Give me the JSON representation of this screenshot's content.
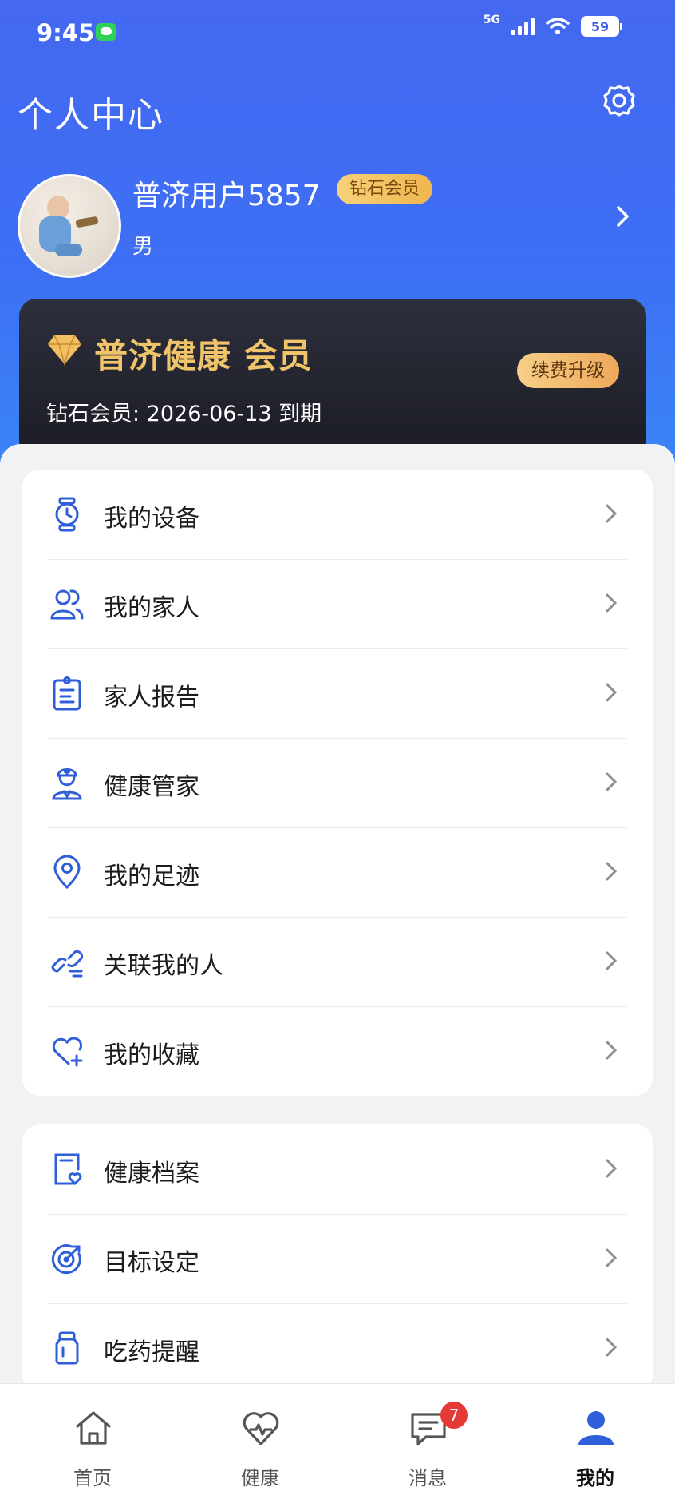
{
  "status_bar": {
    "time": "9:45",
    "network": "5G",
    "battery": "59"
  },
  "header": {
    "title": "个人中心"
  },
  "profile": {
    "name": "普济用户5857",
    "level_badge": "钻石会员",
    "gender": "男"
  },
  "member_card": {
    "title": "普济健康 会员",
    "expiry": "钻石会员: 2026-06-13 到期",
    "renew_button": "续费升级"
  },
  "menu_group_1": [
    {
      "label": "我的设备",
      "icon": "watch-icon"
    },
    {
      "label": "我的家人",
      "icon": "family-icon"
    },
    {
      "label": "家人报告",
      "icon": "clipboard-icon"
    },
    {
      "label": "健康管家",
      "icon": "doctor-icon"
    },
    {
      "label": "我的足迹",
      "icon": "location-pin-icon"
    },
    {
      "label": "关联我的人",
      "icon": "link-icon"
    },
    {
      "label": "我的收藏",
      "icon": "heart-plus-icon"
    }
  ],
  "menu_group_2": [
    {
      "label": "健康档案",
      "icon": "health-file-icon"
    },
    {
      "label": "目标设定",
      "icon": "target-icon"
    },
    {
      "label": "吃药提醒",
      "icon": "pill-bottle-icon"
    }
  ],
  "bottom_nav": [
    {
      "label": "首页",
      "icon": "home-icon"
    },
    {
      "label": "健康",
      "icon": "heart-pulse-icon"
    },
    {
      "label": "消息",
      "icon": "message-icon",
      "badge": "7"
    },
    {
      "label": "我的",
      "icon": "user-icon",
      "active": true
    }
  ],
  "colors": {
    "primary": "#3d6ff4",
    "icon_blue": "#2f5fd8",
    "gold": "#f0c46a",
    "badge_red": "#e53935"
  }
}
